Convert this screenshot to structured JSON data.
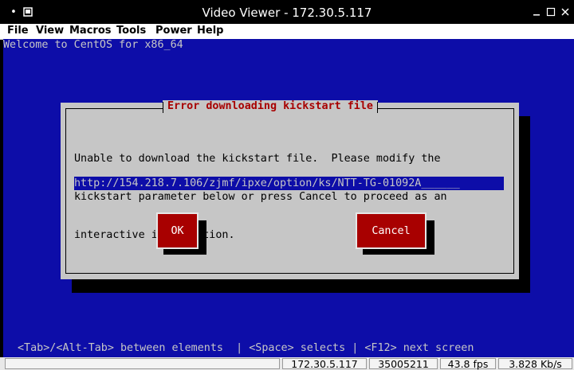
{
  "window": {
    "title": "Video Viewer - 172.30.5.117",
    "left_icons": [
      "bullet-icon",
      "window-menu-icon"
    ],
    "controls": [
      "minimize-icon",
      "maximize-icon",
      "close-icon"
    ]
  },
  "menu": {
    "items": [
      "File",
      "View",
      "Macros",
      "Tools",
      "Power",
      "Help"
    ]
  },
  "console": {
    "welcome": "Welcome to CentOS for x86_64",
    "dialog": {
      "title": "Error downloading kickstart file",
      "message_lines": [
        "Unable to download the kickstart file.  Please modify the",
        "kickstart parameter below or press Cancel to proceed as an",
        "interactive installation."
      ],
      "url_value": "http://154.218.7.106/zjmf/ipxe/option/ks/NTT-TG-01092A______",
      "ok_label": "OK",
      "cancel_label": "Cancel"
    },
    "help_line": "<Tab>/<Alt-Tab> between elements  | <Space> selects | <F12> next screen",
    "colors": {
      "background": "#0d0da8",
      "dialog": "#c6c6c6",
      "title_text": "#a80000",
      "button": "#a80000"
    }
  },
  "statusbar": {
    "cells": [
      "",
      "172.30.5.117",
      "35005211",
      "43.8 fps",
      "3.828 Kb/s"
    ]
  }
}
